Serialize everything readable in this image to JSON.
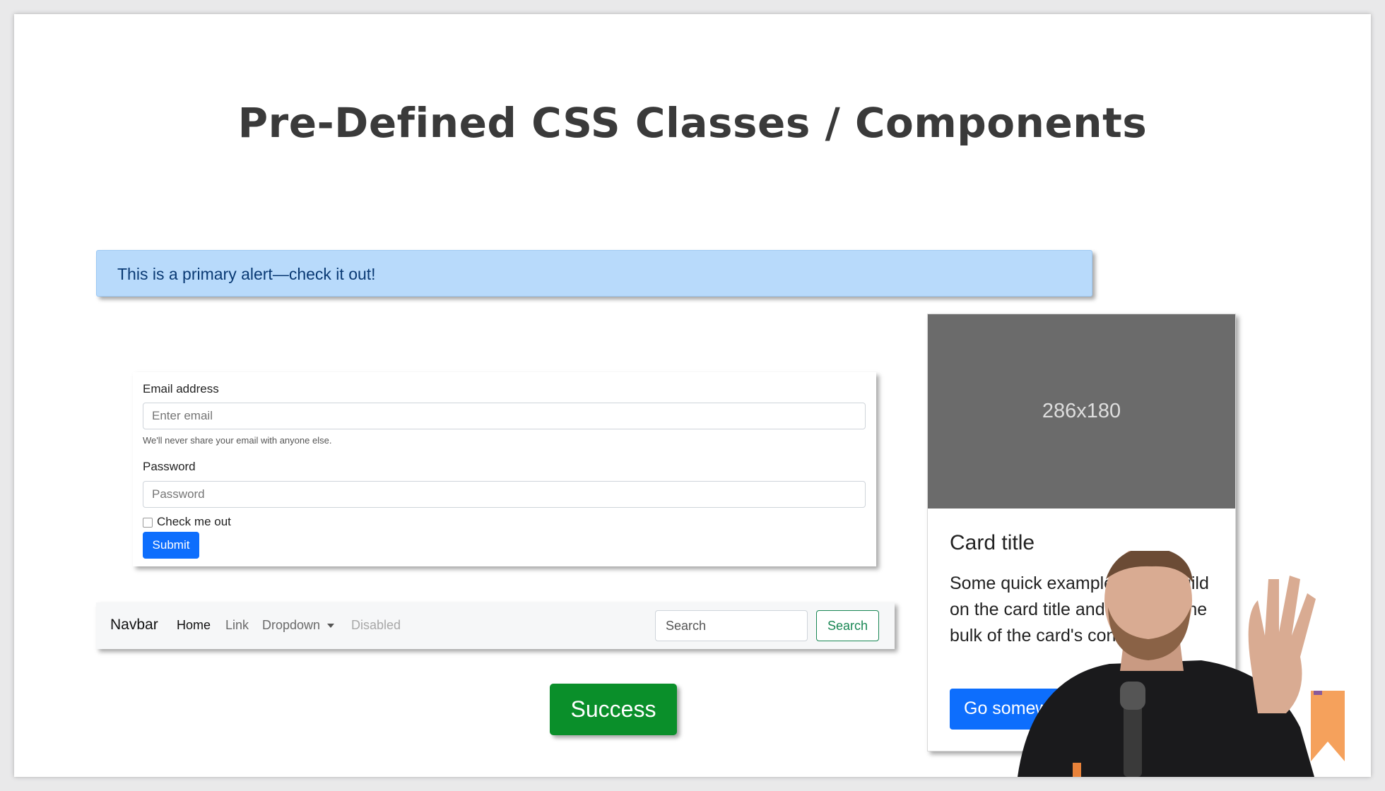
{
  "slide": {
    "title": "Pre-Defined CSS Classes / Components"
  },
  "alert": {
    "text": "This is a primary alert—check it out!"
  },
  "form": {
    "email_label": "Email address",
    "email_placeholder": "Enter email",
    "email_help": "We'll never share your email with anyone else.",
    "password_label": "Password",
    "password_placeholder": "Password",
    "checkbox_label": "Check me out",
    "submit_label": "Submit"
  },
  "navbar": {
    "brand": "Navbar",
    "items": [
      {
        "label": "Home",
        "state": "active"
      },
      {
        "label": "Link",
        "state": "normal"
      },
      {
        "label": "Dropdown",
        "state": "normal"
      },
      {
        "label": "Disabled",
        "state": "disabled"
      }
    ],
    "search_placeholder": "Search",
    "search_button": "Search"
  },
  "success_button": "Success",
  "card": {
    "image_label": "286x180",
    "title": "Card title",
    "text": "Some quick example text to build on the card title and make up the bulk of the card's content.",
    "button": "Go somewhere"
  },
  "colors": {
    "alert_bg": "#b8dafb",
    "primary": "#0d6efd",
    "success": "#0a8f2a",
    "navbar_bg": "#f6f7f8",
    "card_image_bg": "#6b6b6b",
    "logo": "#f5a15c"
  },
  "icons": {
    "dropdown_caret": "caret-down-icon",
    "logo": "bookmark-logo-icon",
    "presenter": "presenter-video-overlay"
  }
}
